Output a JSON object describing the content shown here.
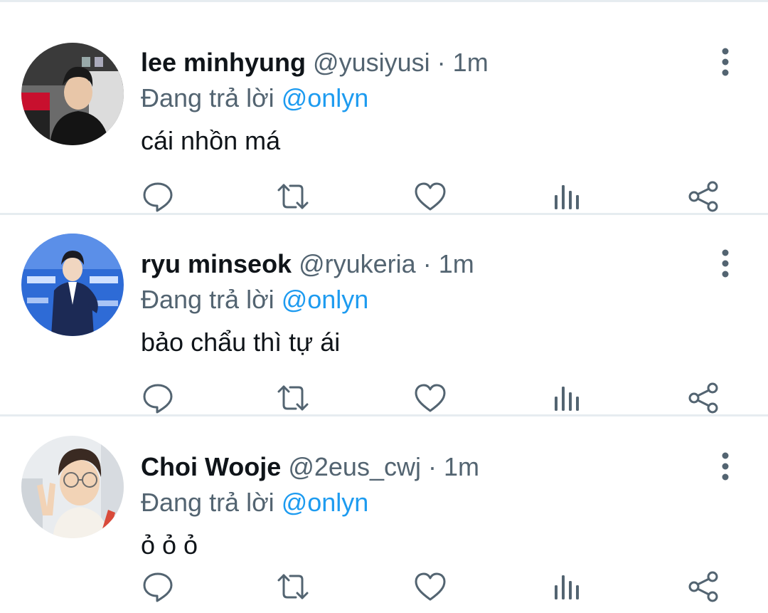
{
  "tweets": [
    {
      "name": "lee minhyung",
      "handle": "@yusiyusi",
      "separator": "·",
      "time": "1m",
      "reply_prefix": "Đang trả lời",
      "reply_to": "@onlyn",
      "text": "cái nhồn má"
    },
    {
      "name": "ryu minseok",
      "handle": "@ryukeria",
      "separator": "·",
      "time": "1m",
      "reply_prefix": "Đang trả lời",
      "reply_to": "@onlyn",
      "text": "bảo chẩu thì tự ái"
    },
    {
      "name": "Choi Wooje",
      "handle": "@2eus_cwj",
      "separator": "·",
      "time": "1m",
      "reply_prefix": "Đang trả lời",
      "reply_to": "@onlyn",
      "text": "ỏ ỏ ỏ"
    }
  ],
  "icons": {
    "more": "more-vertical-icon",
    "reply": "reply-icon",
    "retweet": "retweet-icon",
    "like": "heart-icon",
    "analytics": "analytics-icon",
    "share": "share-icon"
  },
  "colors": {
    "name": "#0f1419",
    "secondary": "#536471",
    "mention": "#1d9bf0",
    "divider": "#e6ecf0"
  }
}
